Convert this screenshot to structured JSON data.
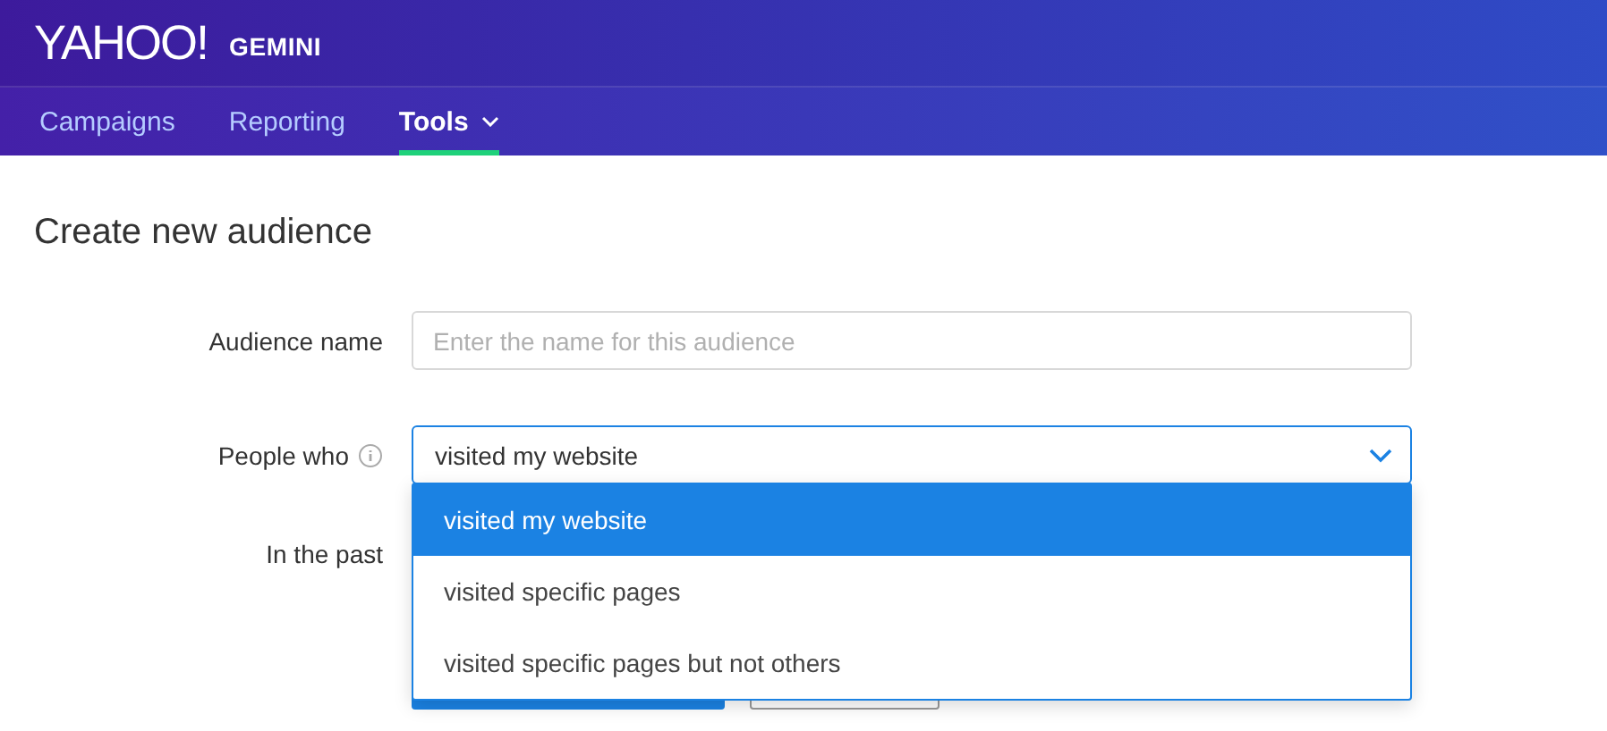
{
  "header": {
    "logo": "YAHOO!",
    "product": "GEMINI"
  },
  "nav": [
    {
      "label": "Campaigns",
      "selected": false,
      "has_menu": false
    },
    {
      "label": "Reporting",
      "selected": false,
      "has_menu": false
    },
    {
      "label": "Tools",
      "selected": true,
      "has_menu": true
    }
  ],
  "page_title": "Create new audience",
  "form": {
    "audience_name": {
      "label": "Audience name",
      "placeholder": "Enter the name for this audience"
    },
    "people_who": {
      "label": "People who",
      "value": "visited my website",
      "expanded": true,
      "options": [
        {
          "label": "visited my website",
          "selected": true
        },
        {
          "label": "visited specific pages",
          "selected": false
        },
        {
          "label": "visited specific pages but not others",
          "selected": false
        }
      ]
    },
    "in_the_past": {
      "label": "In the past"
    }
  }
}
